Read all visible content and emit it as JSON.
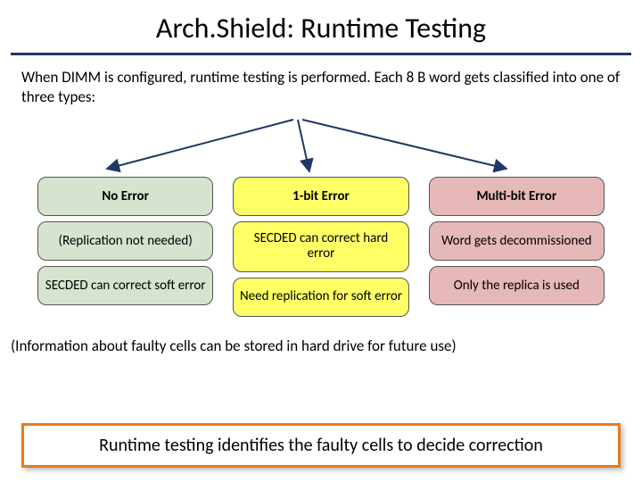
{
  "title": "Arch.Shield: Runtime Testing",
  "intro": "When DIMM is configured, runtime testing is performed. Each 8 B word gets classified into one of three types:",
  "columns": [
    {
      "header": "No Error",
      "row1": "(Replication not needed)",
      "row2": "SECDED can correct soft error"
    },
    {
      "header": "1-bit Error",
      "row1": "SECDED can correct hard error",
      "row2": "Need replication for soft error"
    },
    {
      "header": "Multi-bit Error",
      "row1": "Word gets decommissioned",
      "row2": "Only the replica is used"
    }
  ],
  "footnote": "(Information about faulty cells can be stored in hard drive for future use)",
  "callout": "Runtime testing identifies the faulty cells to decide correction"
}
